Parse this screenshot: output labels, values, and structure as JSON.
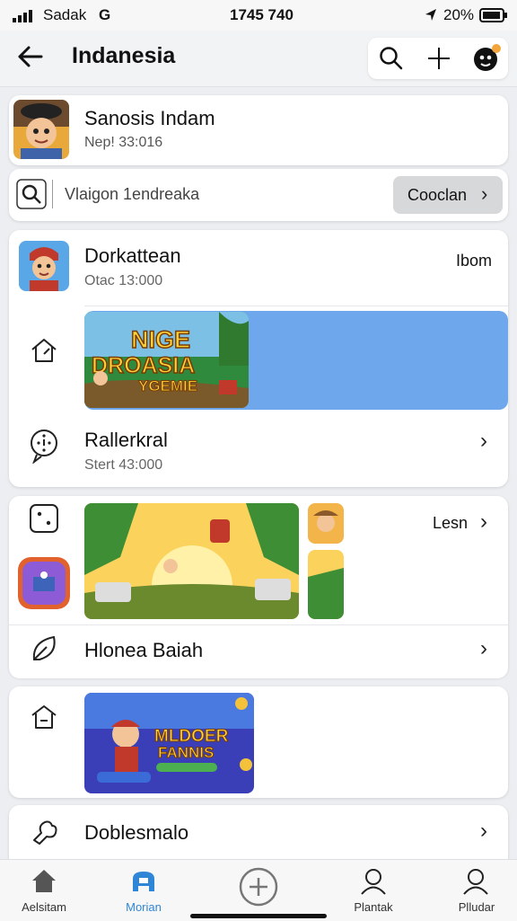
{
  "status": {
    "carrier": "Sadak",
    "carrier_extra": "G",
    "time": "1745 740",
    "battery": "20%"
  },
  "header": {
    "title": "Indanesia"
  },
  "profile": {
    "name": "Sanosis Indam",
    "subtitle": "Nep! 33:016"
  },
  "search": {
    "value": "Vlaigon 1endreaka",
    "button": "Cooclan"
  },
  "game1": {
    "title": "Dorkattean",
    "subtitle": "Otac 13:000",
    "trailing": "Ibom"
  },
  "banner1": {
    "line1": "NIGE",
    "line2": "DROASIA",
    "line3": "YGEMIE"
  },
  "row2": {
    "title": "Rallerkral",
    "subtitle": "Stert 43:000"
  },
  "section3": {
    "link": "Lesn"
  },
  "row3": {
    "title": "Hlonea Baiah"
  },
  "banner2": {
    "line1": "MLDOER",
    "line2": "FANNIS"
  },
  "row4": {
    "title": "Doblesmalo"
  },
  "nav": {
    "items": [
      "Aelsitam",
      "Morian",
      "",
      "Plantak",
      "Plludar"
    ]
  },
  "colors": {
    "accent": "#2f86d6",
    "banner_blue": "#6ea7ec"
  }
}
